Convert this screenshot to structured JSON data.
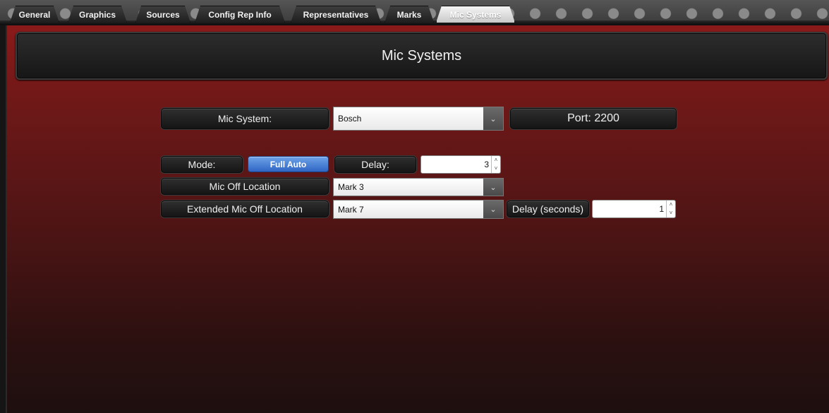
{
  "tabs": [
    {
      "label": "General"
    },
    {
      "label": "Graphics"
    },
    {
      "label": "Sources"
    },
    {
      "label": "Config Rep Info"
    },
    {
      "label": "Representatives"
    },
    {
      "label": "Marks"
    },
    {
      "label": "Mic Systems",
      "active": true
    }
  ],
  "page": {
    "title": "Mic Systems"
  },
  "mic_system": {
    "label": "Mic System:",
    "selected": "Bosch",
    "port_label": "Port: 2200"
  },
  "mode": {
    "label": "Mode:",
    "button": "Full Auto",
    "delay_label": "Delay:",
    "delay_value": "3"
  },
  "mic_off": {
    "label": "Mic Off Location",
    "selected": "Mark 3"
  },
  "extended_mic_off": {
    "label": "Extended Mic Off Location",
    "selected": "Mark 7",
    "delay_label": "Delay (seconds)",
    "delay_value": "1"
  },
  "icons": {
    "dropdown_arrow": "chevron-down-icon",
    "spin_up": "chevron-up-icon",
    "spin_down": "chevron-down-icon"
  },
  "colors": {
    "panel_top": "#8a1a1a",
    "panel_bottom": "#1e0f0f",
    "accent_button": "#3a72d0"
  }
}
